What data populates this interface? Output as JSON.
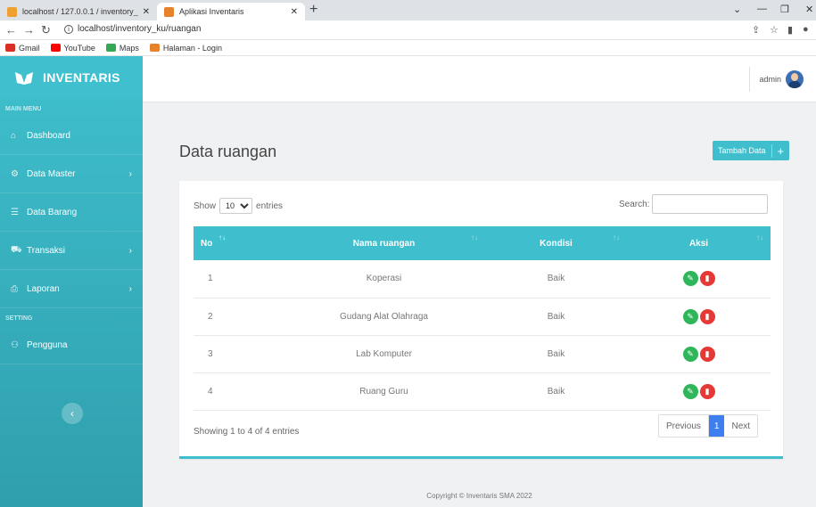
{
  "browser": {
    "tabs": [
      {
        "title": "localhost / 127.0.0.1 / inventory_",
        "close": "✕"
      },
      {
        "title": "Aplikasi Inventaris",
        "close": "✕"
      }
    ],
    "new_tab": "+",
    "url": "localhost/inventory_ku/ruangan",
    "bookmarks": [
      "Gmail",
      "YouTube",
      "Maps",
      "Halaman - Login"
    ]
  },
  "sidebar": {
    "brand": "INVENTARIS",
    "main_menu_label": "MAIN MENU",
    "setting_label": "SETTING",
    "items": [
      {
        "label": "Dashboard"
      },
      {
        "label": "Data Master"
      },
      {
        "label": "Data Barang"
      },
      {
        "label": "Transaksi"
      },
      {
        "label": "Laporan"
      },
      {
        "label": "Pengguna"
      }
    ]
  },
  "header": {
    "user": "admin"
  },
  "main": {
    "title": "Data ruangan",
    "add_button": "Tambah Data",
    "add_plus": "+",
    "show_label": "Show",
    "entries_label": "entries",
    "page_size": "10",
    "search_label": "Search:",
    "columns": [
      "No",
      "Nama ruangan",
      "Kondisi",
      "Aksi"
    ],
    "rows": [
      {
        "no": "1",
        "nama": "Koperasi",
        "kondisi": "Baik"
      },
      {
        "no": "2",
        "nama": "Gudang Alat Olahraga",
        "kondisi": "Baik"
      },
      {
        "no": "3",
        "nama": "Lab Komputer",
        "kondisi": "Baik"
      },
      {
        "no": "4",
        "nama": "Ruang Guru",
        "kondisi": "Baik"
      }
    ],
    "info": "Showing 1 to 4 of 4 entries",
    "pagination": {
      "previous": "Previous",
      "current": "1",
      "next": "Next"
    }
  },
  "footer": "Copyright © Inventaris SMA 2022",
  "colors": {
    "accent": "#3fbfcd",
    "edit": "#2fb65a",
    "delete": "#e53935",
    "page_active": "#3d7ff0"
  }
}
